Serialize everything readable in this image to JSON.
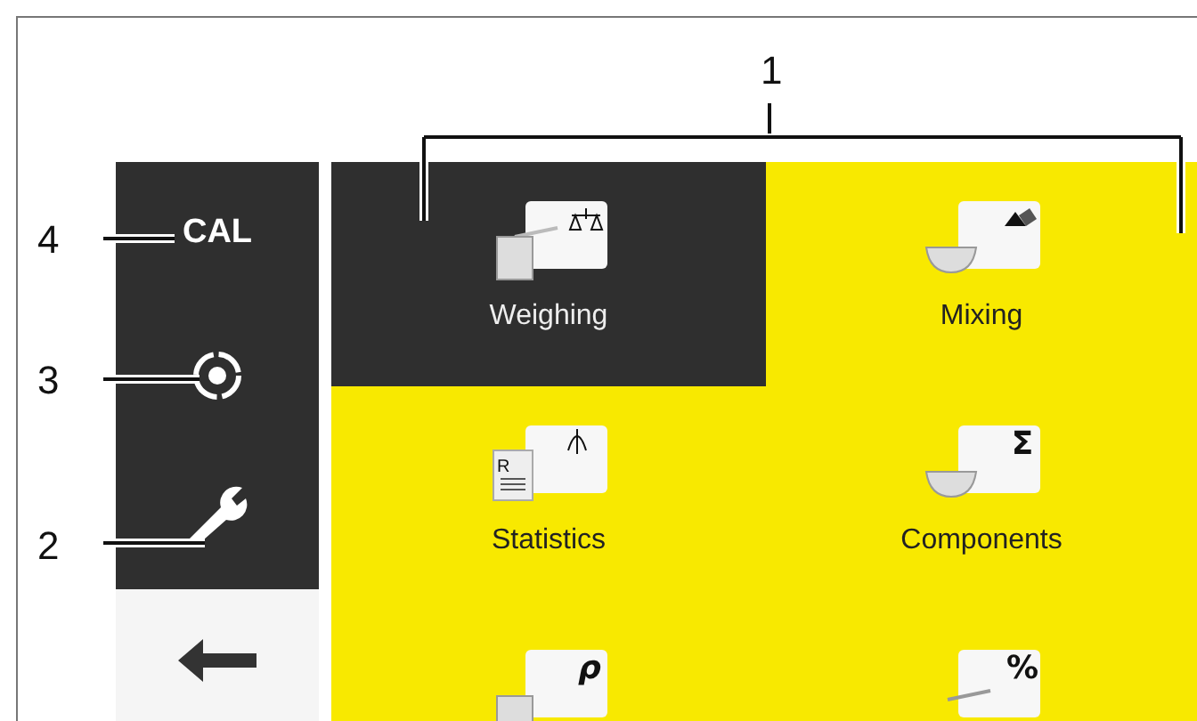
{
  "callouts": [
    {
      "label": "1"
    },
    {
      "label": "4"
    },
    {
      "label": "3"
    },
    {
      "label": "2"
    }
  ],
  "sidebar": {
    "items": [
      {
        "kind": "cal",
        "label": "CAL"
      },
      {
        "kind": "target"
      },
      {
        "kind": "wrench"
      },
      {
        "kind": "back"
      }
    ]
  },
  "tiles": [
    {
      "kind": "weighing",
      "label": "Weighing",
      "selected": true
    },
    {
      "kind": "mixing",
      "label": "Mixing",
      "selected": false
    },
    {
      "kind": "statistics",
      "label": "Statistics",
      "symbol": "R",
      "selected": false
    },
    {
      "kind": "components",
      "label": "Components",
      "symbol": "Σ",
      "selected": false
    },
    {
      "kind": "density",
      "symbol": "ρ",
      "selected": false
    },
    {
      "kind": "percent",
      "symbol": "%",
      "selected": false
    }
  ]
}
